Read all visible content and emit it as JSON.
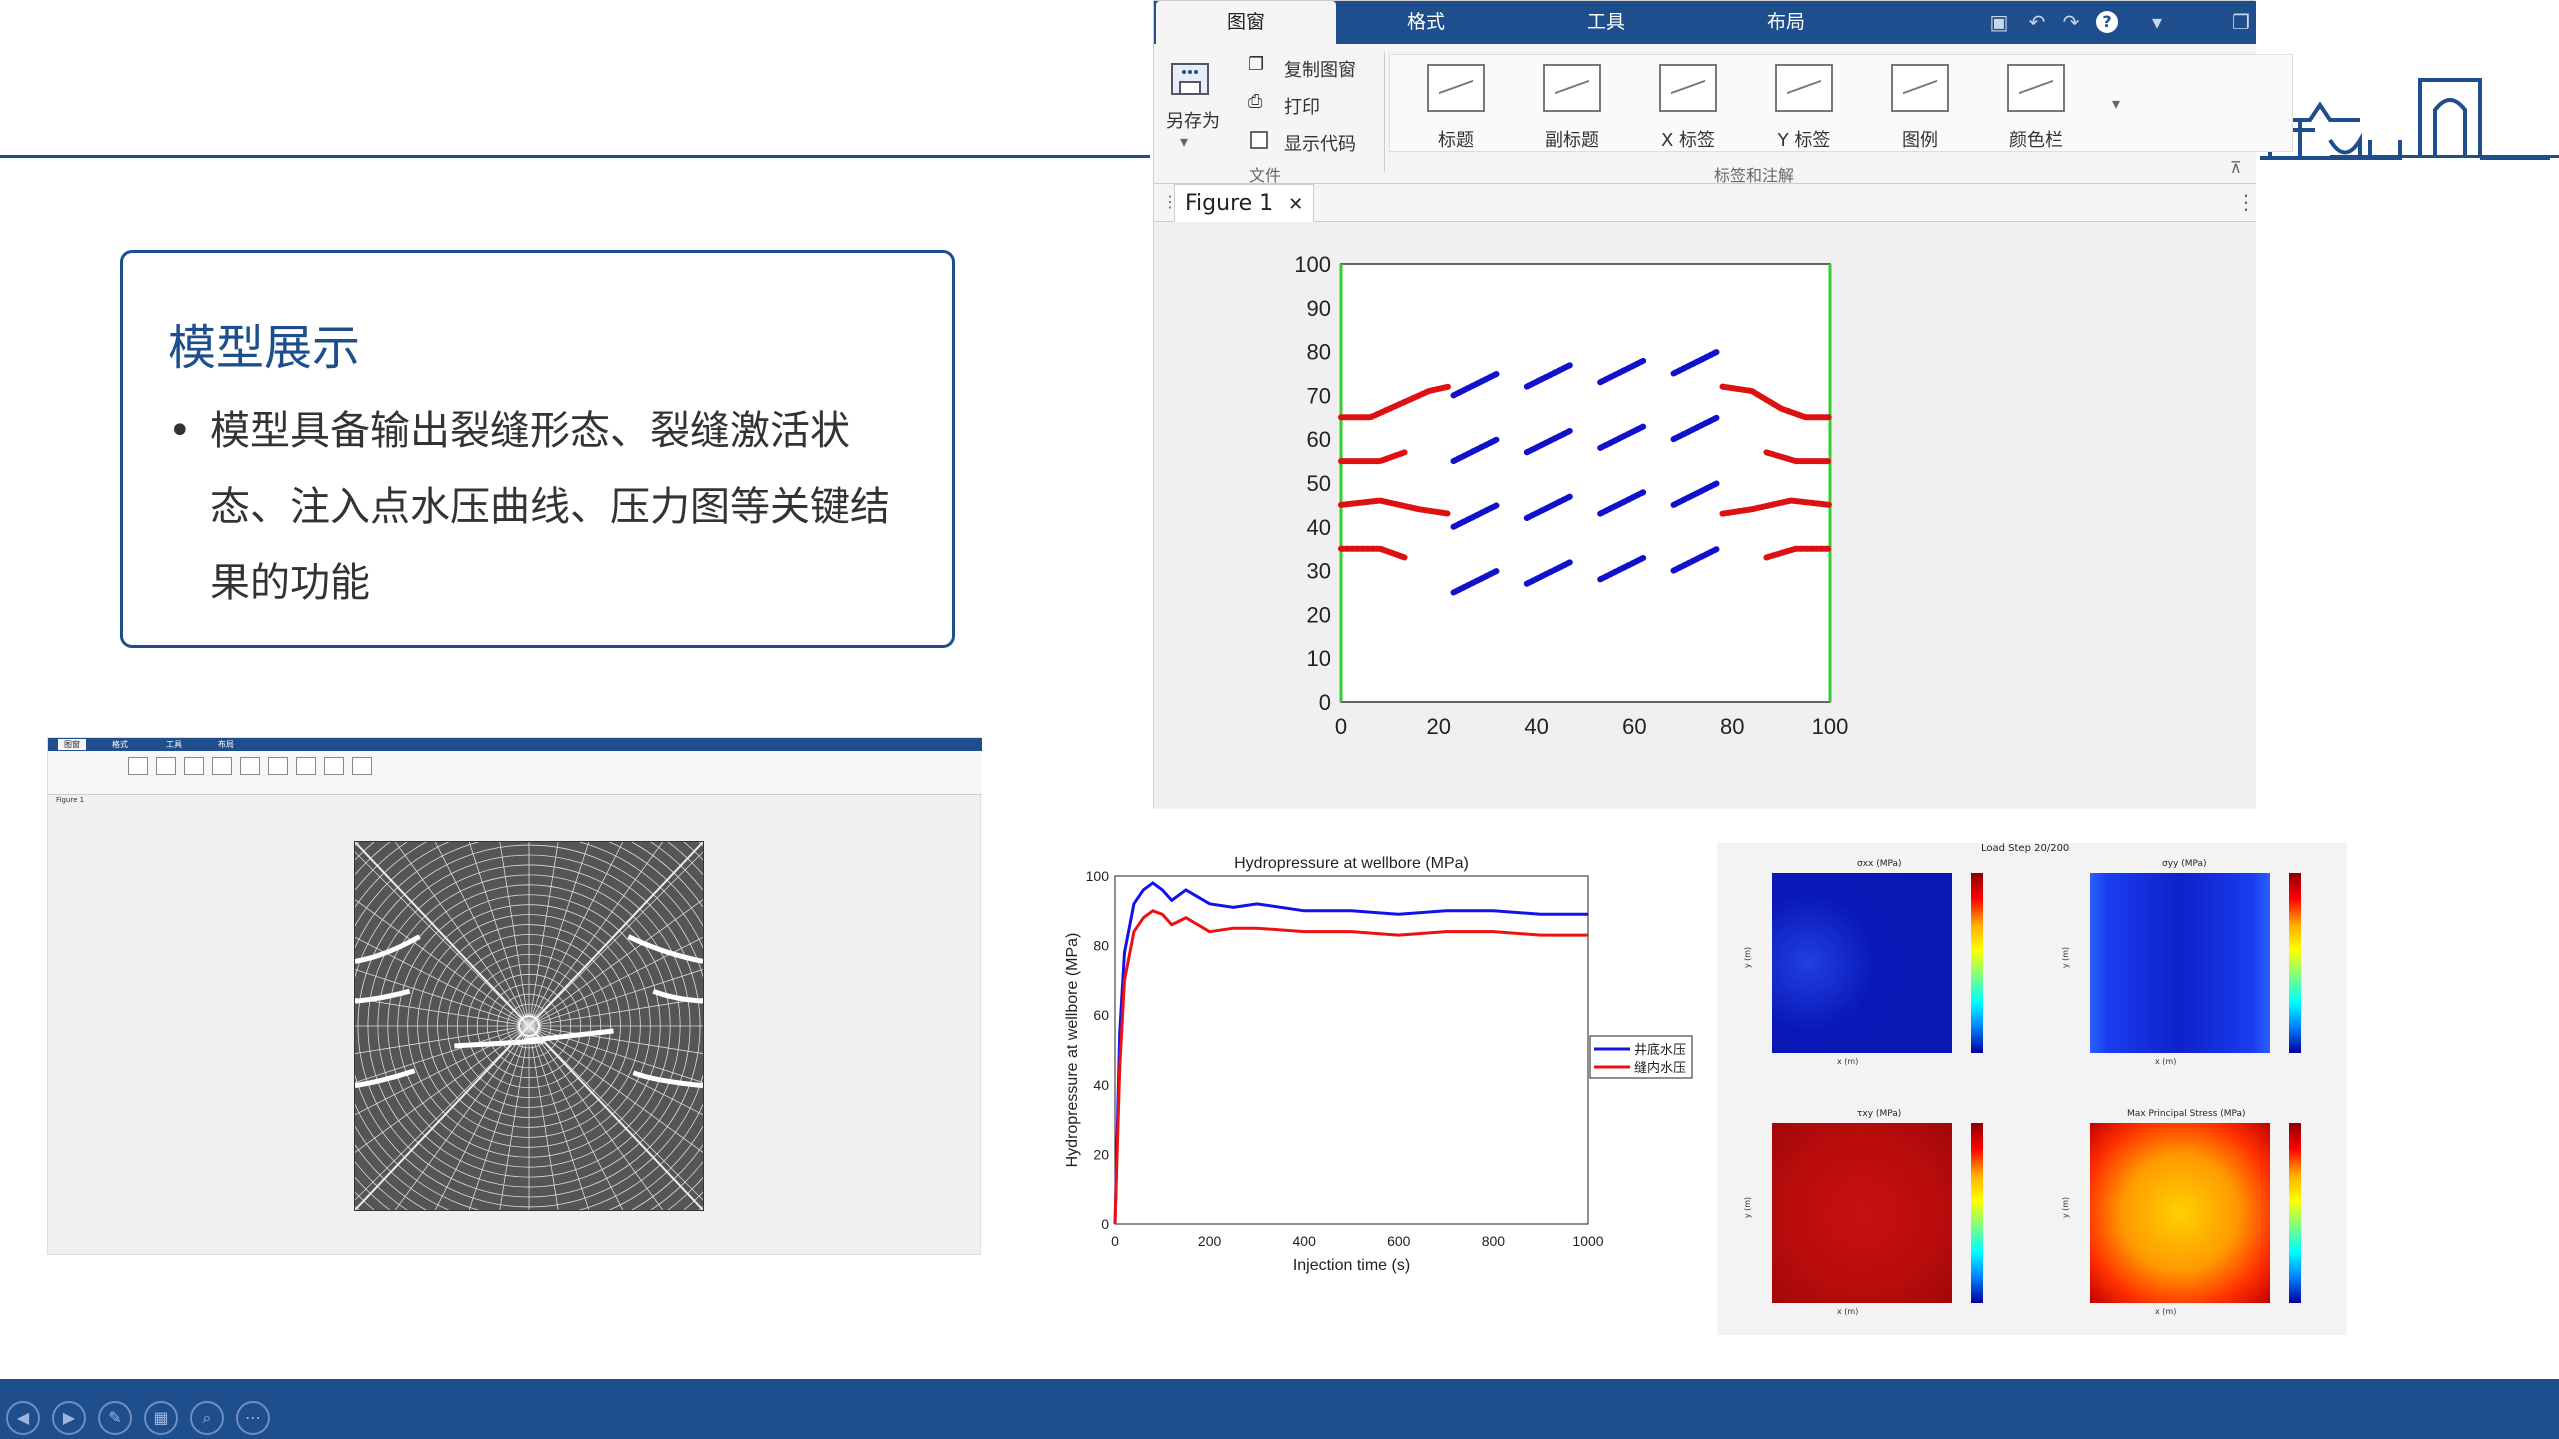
{
  "slide": {
    "title": "模型展示",
    "bullet": "模型具备输出裂缝形态、裂缝激活状态、注入点水压曲线、压力图等关键结果的功能"
  },
  "matlab": {
    "tabs": [
      "图窗",
      "格式",
      "工具",
      "布局"
    ],
    "file_group": {
      "save_as": "另存为",
      "copy_figure": "复制图窗",
      "print": "打印",
      "show_code": "显示代码",
      "label": "文件"
    },
    "label_group": {
      "buttons": [
        "标题",
        "副标题",
        "X 标签",
        "Y 标签",
        "图例",
        "颜色栏"
      ],
      "label": "标签和注解"
    },
    "figure_tab": "Figure 1",
    "close_glyph": "✕"
  },
  "small_window": {
    "tabs": [
      "图窗",
      "格式",
      "工具",
      "布局"
    ],
    "figure_tab": "Figure 1"
  },
  "chart_data": [
    {
      "type": "scatter",
      "title": "",
      "xlabel": "",
      "ylabel": "",
      "xlim": [
        0,
        100
      ],
      "ylim": [
        0,
        100
      ],
      "xticks": [
        0,
        20,
        40,
        60,
        80,
        100
      ],
      "yticks": [
        0,
        10,
        20,
        30,
        40,
        50,
        60,
        70,
        80,
        90,
        100
      ],
      "series": [
        {
          "color": "#dd1111",
          "segments": [
            [
              [
                0,
                65
              ],
              [
                6,
                65
              ],
              [
                12,
                68
              ],
              [
                18,
                71
              ],
              [
                22,
                72
              ]
            ],
            [
              [
                0,
                55
              ],
              [
                8,
                55
              ],
              [
                13,
                57
              ]
            ],
            [
              [
                0,
                45
              ],
              [
                8,
                46
              ],
              [
                16,
                44
              ],
              [
                22,
                43
              ]
            ],
            [
              [
                0,
                35
              ],
              [
                8,
                35
              ],
              [
                13,
                33
              ]
            ],
            [
              [
                78,
                72
              ],
              [
                84,
                71
              ],
              [
                90,
                67
              ],
              [
                95,
                65
              ],
              [
                100,
                65
              ]
            ],
            [
              [
                87,
                57
              ],
              [
                93,
                55
              ],
              [
                100,
                55
              ]
            ],
            [
              [
                78,
                43
              ],
              [
                84,
                44
              ],
              [
                92,
                46
              ],
              [
                100,
                45
              ]
            ],
            [
              [
                87,
                33
              ],
              [
                93,
                35
              ],
              [
                100,
                35
              ]
            ]
          ]
        },
        {
          "color": "#1111cc",
          "segments": [
            [
              [
                23,
                70
              ],
              [
                32,
                75
              ]
            ],
            [
              [
                38,
                72
              ],
              [
                47,
                77
              ]
            ],
            [
              [
                53,
                73
              ],
              [
                62,
                78
              ]
            ],
            [
              [
                68,
                75
              ],
              [
                77,
                80
              ]
            ],
            [
              [
                23,
                55
              ],
              [
                32,
                60
              ]
            ],
            [
              [
                38,
                57
              ],
              [
                47,
                62
              ]
            ],
            [
              [
                53,
                58
              ],
              [
                62,
                63
              ]
            ],
            [
              [
                68,
                60
              ],
              [
                77,
                65
              ]
            ],
            [
              [
                23,
                40
              ],
              [
                32,
                45
              ]
            ],
            [
              [
                38,
                42
              ],
              [
                47,
                47
              ]
            ],
            [
              [
                53,
                43
              ],
              [
                62,
                48
              ]
            ],
            [
              [
                68,
                45
              ],
              [
                77,
                50
              ]
            ],
            [
              [
                23,
                25
              ],
              [
                32,
                30
              ]
            ],
            [
              [
                38,
                27
              ],
              [
                47,
                32
              ]
            ],
            [
              [
                53,
                28
              ],
              [
                62,
                33
              ]
            ],
            [
              [
                68,
                30
              ],
              [
                77,
                35
              ]
            ]
          ]
        }
      ],
      "boundary_color": "#33cc33"
    },
    {
      "type": "line",
      "title": "Hydropressure at wellbore (MPa)",
      "xlabel": "Injection time (s)",
      "ylabel": "Hydropressure at wellbore (MPa)",
      "xlim": [
        0,
        1000
      ],
      "ylim": [
        0,
        100
      ],
      "xticks": [
        0,
        200,
        400,
        600,
        800,
        1000
      ],
      "yticks": [
        0,
        20,
        40,
        60,
        80,
        100
      ],
      "series": [
        {
          "name": "井底水压",
          "color": "#1111ee",
          "x": [
            0,
            10,
            20,
            40,
            60,
            80,
            100,
            120,
            150,
            200,
            250,
            300,
            400,
            500,
            600,
            700,
            800,
            900,
            1000
          ],
          "y": [
            0,
            55,
            78,
            92,
            96,
            98,
            96,
            93,
            96,
            92,
            91,
            92,
            90,
            90,
            89,
            90,
            90,
            89,
            89
          ]
        },
        {
          "name": "缝内水压",
          "color": "#ee1111",
          "x": [
            0,
            10,
            20,
            40,
            60,
            80,
            100,
            120,
            150,
            200,
            250,
            300,
            400,
            500,
            600,
            700,
            800,
            900,
            1000
          ],
          "y": [
            0,
            45,
            70,
            84,
            88,
            90,
            89,
            86,
            88,
            84,
            85,
            85,
            84,
            84,
            83,
            84,
            84,
            83,
            83
          ]
        }
      ]
    }
  ],
  "stress": {
    "header": "Load Step 20/200",
    "panels": [
      "σxx (MPa)",
      "σyy (MPa)",
      "τxy (MPa)",
      "Max Principal Stress (MPa)"
    ],
    "xlabel": "x (m)",
    "ylabel": "y (m)"
  }
}
